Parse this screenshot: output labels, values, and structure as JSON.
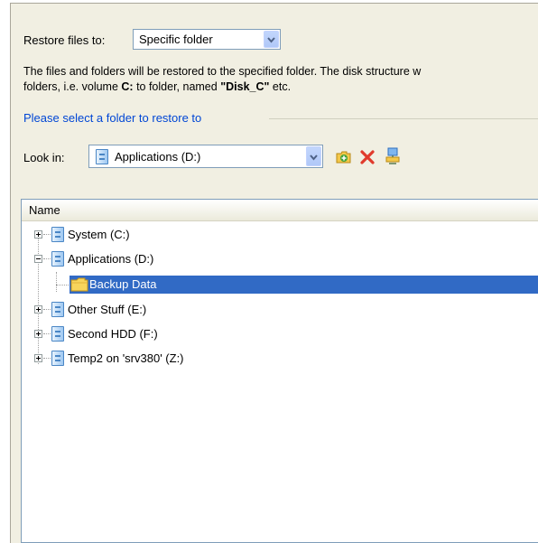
{
  "restore": {
    "label": "Restore files to:",
    "mode": "Specific folder"
  },
  "info": {
    "line1": "The files and folders will be restored to the specified folder. The disk structure w",
    "line2_a": "folders, i.e. volume ",
    "line2_vol": "C:",
    "line2_b": " to folder, named ",
    "line2_name": "\"Disk_C\"",
    "line2_c": " etc."
  },
  "select_folder_title": "Please select a folder to restore to",
  "look_in": {
    "label": "Look in:",
    "value": "Applications (D:)"
  },
  "tree": {
    "header": "Name",
    "items": [
      {
        "label": "System (C:)",
        "expanded": false
      },
      {
        "label": "Applications (D:)",
        "expanded": true
      },
      {
        "label": "Backup Data",
        "selected": true
      },
      {
        "label": "Other Stuff (E:)",
        "expanded": false
      },
      {
        "label": "Second HDD (F:)",
        "expanded": false
      },
      {
        "label": "Temp2 on 'srv380' (Z:)",
        "expanded": false
      }
    ]
  },
  "colors": {
    "panel_bg": "#f1efe2",
    "accent_blue": "#0046d5",
    "selection": "#316ac5"
  }
}
